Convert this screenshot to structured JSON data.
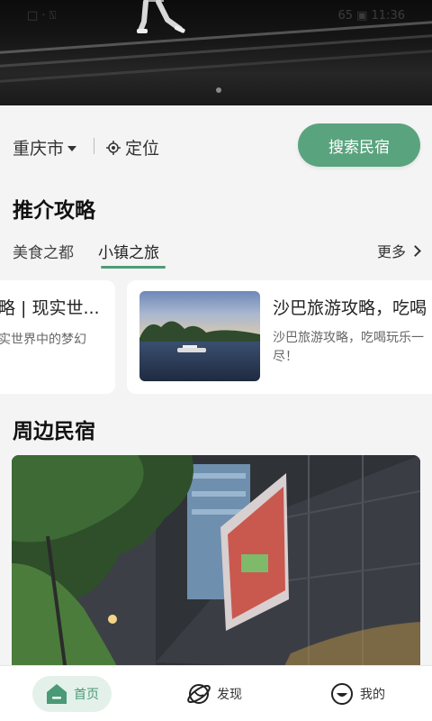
{
  "status_bar": {
    "left": "□ · ⍂",
    "right": "65  ▣ 11:36"
  },
  "banner": {
    "pager_active": 0
  },
  "location": {
    "city": "重庆市",
    "locate_label": "定位",
    "search_button": "搜索民宿"
  },
  "guides": {
    "title": "推介攻略",
    "tabs": [
      "美食之都",
      "小镇之旅"
    ],
    "active_tab": 1,
    "more_label": "更多",
    "cards": [
      {
        "title": "略 | 现实世...",
        "desc": "实世界中的梦幻"
      },
      {
        "title": "沙巴旅游攻略，吃喝",
        "desc_line1": "沙巴旅游攻略，吃喝玩乐一",
        "desc_line2": "尽！"
      }
    ]
  },
  "nearby": {
    "title": "周边民宿"
  },
  "bottom_nav": {
    "home": "首页",
    "discover": "发现",
    "mine": "我的"
  },
  "colors": {
    "accent": "#5aa37f",
    "accent_light": "#e4f1ea",
    "background": "#f4f4f4"
  }
}
